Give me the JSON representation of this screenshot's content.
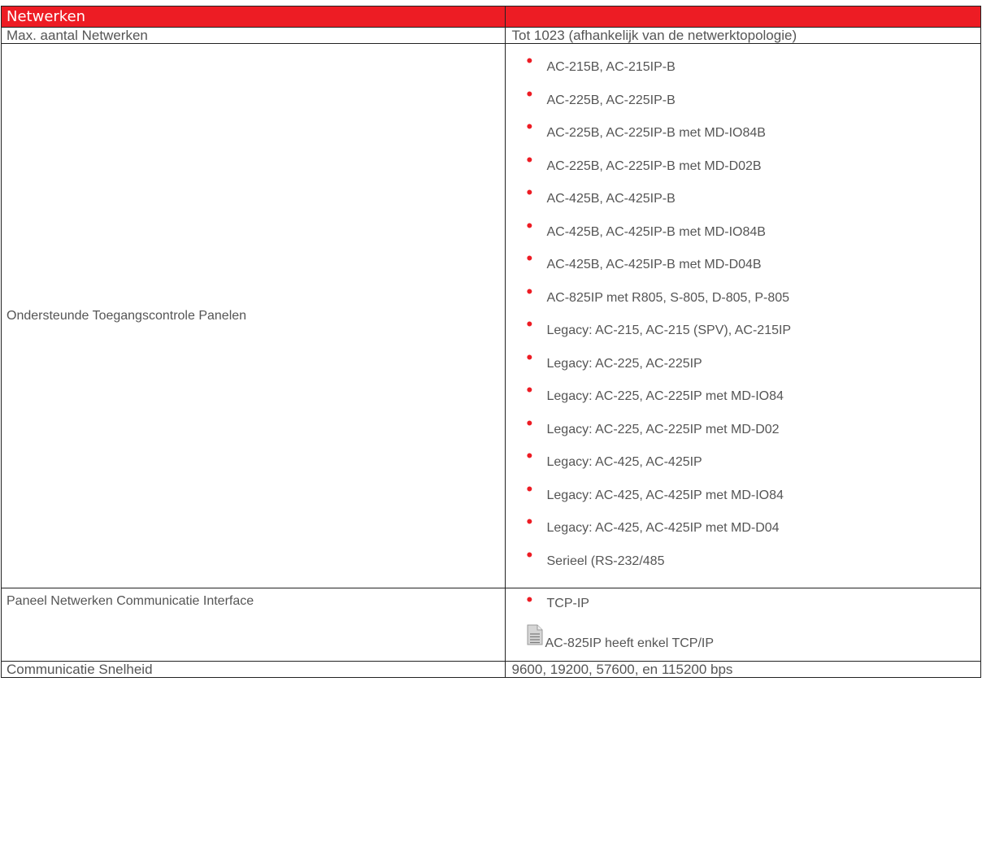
{
  "table": {
    "header_title": "Netwerken",
    "rows": {
      "max_networks": {
        "label": "Max. aantal Netwerken",
        "value": "Tot 1023 (afhankelijk van de netwerktopologie)"
      },
      "supported_panels": {
        "label": "Ondersteunde Toegangscontrole Panelen",
        "items": [
          "AC-215B, AC-215IP-B",
          "AC-225B, AC-225IP-B",
          "AC-225B, AC-225IP-B met MD-IO84B",
          "AC-225B, AC-225IP-B met MD-D02B",
          "AC-425B, AC-425IP-B",
          "AC-425B, AC-425IP-B met MD-IO84B",
          "AC-425B, AC-425IP-B met MD-D04B",
          "AC-825IP met R805, S-805, D-805, P-805",
          "Legacy: AC-215, AC-215 (SPV), AC-215IP",
          "Legacy: AC-225, AC-225IP",
          "Legacy: AC-225, AC-225IP met MD-IO84",
          "Legacy: AC-225, AC-225IP met MD-D02",
          "Legacy: AC-425, AC-425IP",
          "Legacy: AC-425, AC-425IP met MD-IO84",
          "Legacy: AC-425, AC-425IP met MD-D04",
          "Serieel (RS-232/485"
        ]
      },
      "communication_interface": {
        "label": "Paneel Netwerken Communicatie Interface",
        "item": "TCP-IP",
        "note_icon": "note-document-icon",
        "note": "AC-825IP heeft enkel TCP/IP"
      },
      "communication_speed": {
        "label": "Communicatie Snelheid",
        "value": "9600, 19200, 57600, en 115200 bps"
      }
    }
  },
  "colors": {
    "header_background": "#ed1c24",
    "bullet": "#ed1c24",
    "text": "#555555",
    "border": "#222222"
  }
}
